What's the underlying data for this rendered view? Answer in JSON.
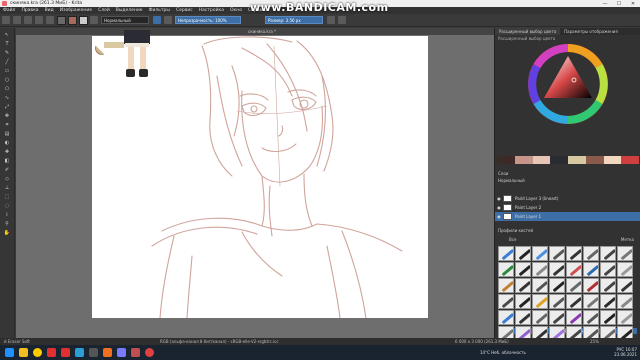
{
  "window": {
    "title": "скиняка.kra (261.3 MиБ) - Krita",
    "controls": [
      "—",
      "☐",
      "✕"
    ]
  },
  "watermark": {
    "text": "www.BANDICAM.com"
  },
  "menu": [
    "Файл",
    "Правка",
    "Вид",
    "Изображение",
    "Слой",
    "Выделение",
    "Фильтры",
    "Сервис",
    "Настройка",
    "Окно",
    "Справка"
  ],
  "toolbar": {
    "blend_mode": "Нормальный",
    "opacity_label": "Непрозрачность: 100%",
    "size_label": "Размер: 3.56 px"
  },
  "document_tab": "скиняка.kra *",
  "right_panel": {
    "tabs": [
      "Расширенный выбор цвета",
      "Параметры отображения"
    ],
    "subtitle": "Расширенный выбор цвета",
    "layers_label": "Слои",
    "layers_mode": "Нормальный",
    "opacity": "Непрозрачность: 100%",
    "layers": [
      {
        "name": "Paint Layer 3 (lineart)"
      },
      {
        "name": "Paint Layer 2"
      },
      {
        "name": "Paint Layer 1"
      }
    ],
    "brushes_title": "Профили кистей",
    "brushes_tag": "Все",
    "brushes_filter": "Метка"
  },
  "status": {
    "left": "й Eraser Soft",
    "center": "RGB (альфа-канал 8 бит/канал) - sRGB-elle-V2-srgbtrc.icc",
    "right": "6 000 x 3 000 (261.3 MиБ)",
    "zoom": "25%"
  },
  "tray": {
    "weather": "14°C",
    "clouds": "Неб. облачность",
    "lang": "РУС",
    "time": "16:07",
    "date": "23.06.2021"
  },
  "colors": {
    "sketch": "#c8958a",
    "accent": "#3d6fa6"
  }
}
